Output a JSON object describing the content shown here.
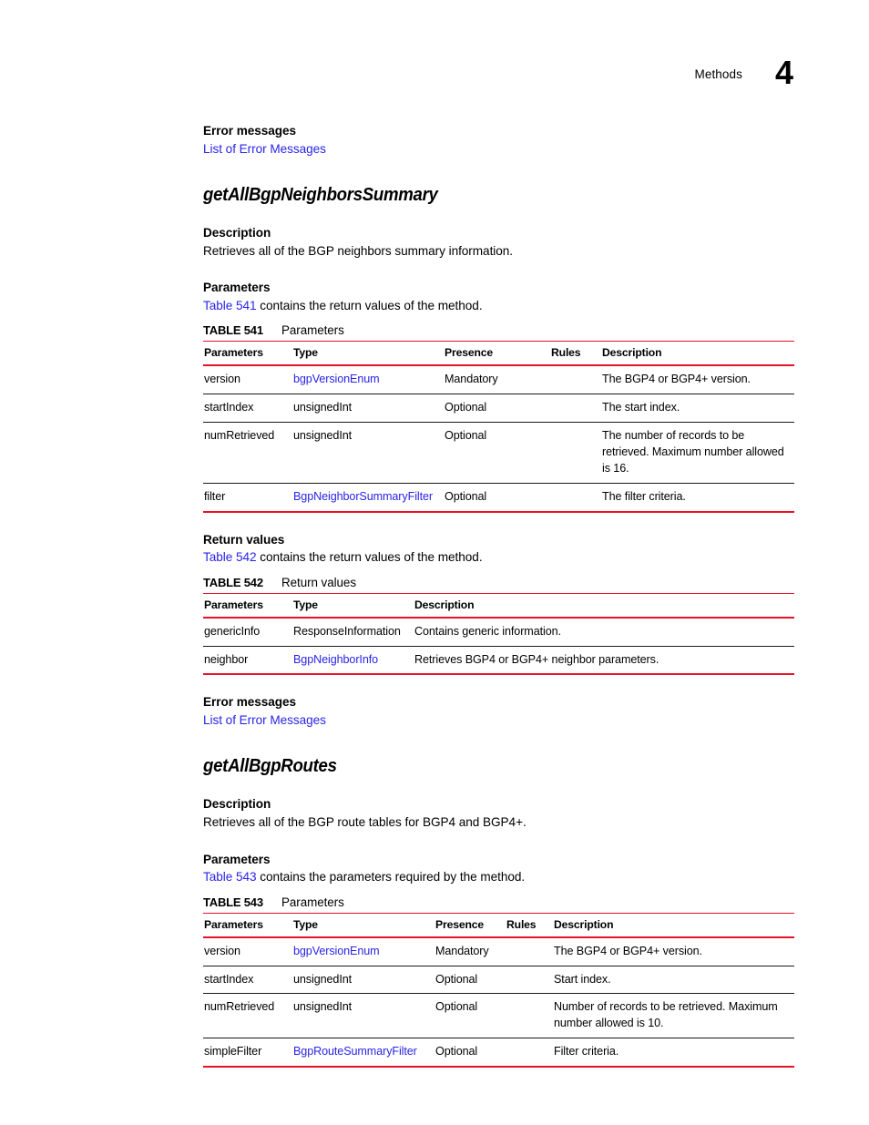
{
  "header": {
    "section_label": "Methods",
    "chapter_number": "4"
  },
  "colors": {
    "link": "#2a24e8",
    "table_rule": "#e8112a",
    "text": "#000000"
  },
  "blocks": {
    "error_messages_heading_1": "Error messages",
    "error_messages_link_1": "List of Error Messages",
    "method_1_title": "getAllBgpNeighborsSummary",
    "description_heading_1": "Description",
    "description_text_1": "Retrieves all of the BGP neighbors summary information.",
    "parameters_heading_1": "Parameters",
    "parameters_ref_link_1": "Table 541",
    "parameters_ref_text_1": " contains the return values of the method.",
    "return_values_heading": "Return values",
    "return_values_ref_link": "Table 542",
    "return_values_ref_text": " contains the return values of the method.",
    "error_messages_heading_2": "Error messages",
    "error_messages_link_2": "List of Error Messages",
    "method_2_title": "getAllBgpRoutes",
    "description_heading_2": "Description",
    "description_text_2": "Retrieves all of the BGP route tables for BGP4 and BGP4+.",
    "parameters_heading_2": "Parameters",
    "parameters_ref_link_2": "Table 543",
    "parameters_ref_text_2": " contains the parameters required by the method."
  },
  "table_541": {
    "caption_number": "TABLE 541",
    "caption_title": "Parameters",
    "columns": [
      "Parameters",
      "Type",
      "Presence",
      "Rules",
      "Description"
    ],
    "rows": [
      {
        "parameter": "version",
        "type": "bgpVersionEnum",
        "type_is_link": true,
        "presence": "Mandatory",
        "rules": "",
        "description": "The BGP4 or BGP4+ version."
      },
      {
        "parameter": "startIndex",
        "type": "unsignedInt",
        "type_is_link": false,
        "presence": "Optional",
        "rules": "",
        "description": "The start index."
      },
      {
        "parameter": "numRetrieved",
        "type": "unsignedInt",
        "type_is_link": false,
        "presence": "Optional",
        "rules": "",
        "description": "The number of records to be retrieved. Maximum number allowed is 16."
      },
      {
        "parameter": "filter",
        "type": "BgpNeighborSummaryFilter",
        "type_is_link": true,
        "presence": "Optional",
        "rules": "",
        "description": "The filter criteria."
      }
    ]
  },
  "table_542": {
    "caption_number": "TABLE 542",
    "caption_title": "Return values",
    "columns": [
      "Parameters",
      "Type",
      "Description"
    ],
    "rows": [
      {
        "parameter": "genericInfo",
        "type": "ResponseInformation",
        "type_is_link": false,
        "description": "Contains generic information."
      },
      {
        "parameter": "neighbor",
        "type": "BgpNeighborInfo",
        "type_is_link": true,
        "description": "Retrieves BGP4 or BGP4+ neighbor parameters."
      }
    ]
  },
  "table_543": {
    "caption_number": "TABLE 543",
    "caption_title": "Parameters",
    "columns": [
      "Parameters",
      "Type",
      "Presence",
      "Rules",
      "Description"
    ],
    "rows": [
      {
        "parameter": "version",
        "type": "bgpVersionEnum",
        "type_is_link": true,
        "presence": "Mandatory",
        "rules": "",
        "description": "The BGP4 or BGP4+ version."
      },
      {
        "parameter": "startIndex",
        "type": "unsignedInt",
        "type_is_link": false,
        "presence": "Optional",
        "rules": "",
        "description": "Start index."
      },
      {
        "parameter": "numRetrieved",
        "type": "unsignedInt",
        "type_is_link": false,
        "presence": "Optional",
        "rules": "",
        "description": "Number of records to be retrieved. Maximum number allowed is 10."
      },
      {
        "parameter": "simpleFilter",
        "type": "BgpRouteSummaryFilter",
        "type_is_link": true,
        "presence": "Optional",
        "rules": "",
        "description": "Filter criteria."
      }
    ]
  }
}
